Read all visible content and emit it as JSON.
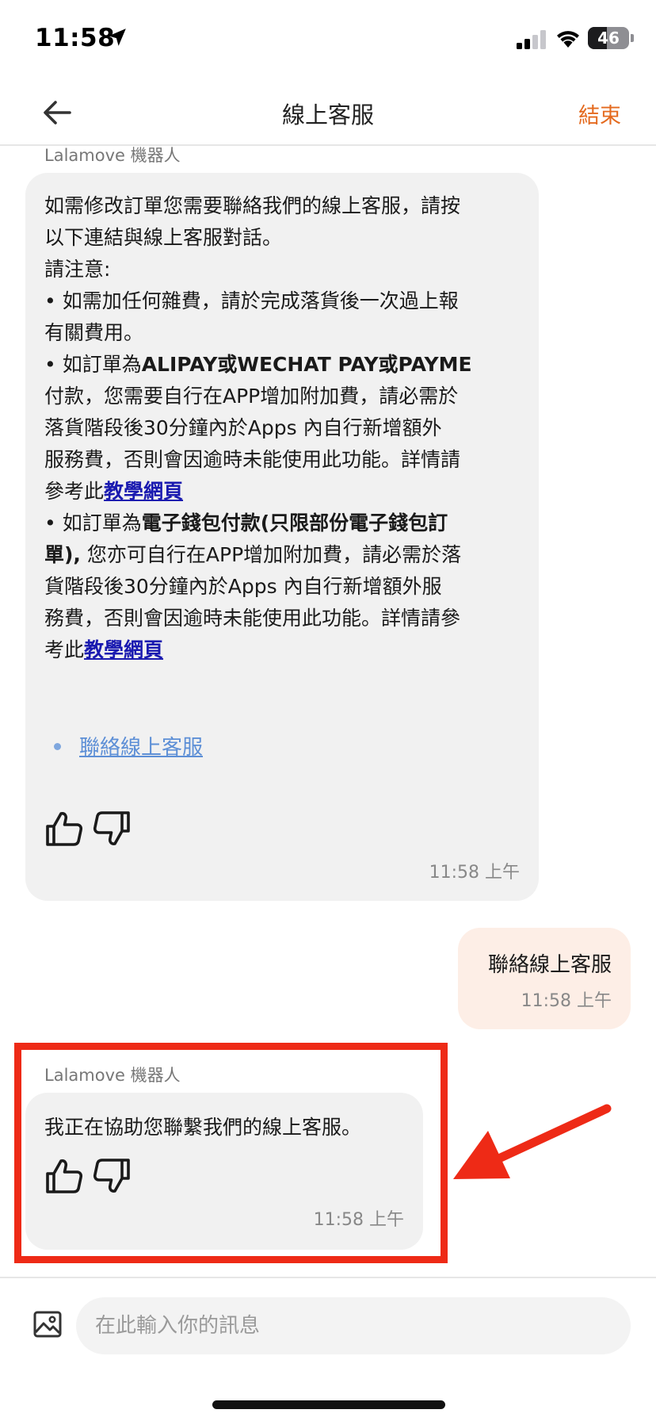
{
  "status_bar": {
    "time": "11:58",
    "battery": "46",
    "battery_level": 0.46
  },
  "header": {
    "title": "線上客服",
    "end_label": "結束"
  },
  "messages": {
    "bot1": {
      "sender": "Lalamove 機器人",
      "line1": "如需修改訂單您需要聯絡我們的線上客服，請按",
      "line2": "以下連結與線上客服對話。",
      "line3": "請注意:",
      "line4": "• 如需加任何雜費，請於完成落貨後一次過上報",
      "line5": "有關費用。",
      "line6_prefix": "• 如訂單為",
      "line6_bold": "ALIPAY或WECHAT PAY或PAYME",
      "line7": "付款，您需要自行在APP增加附加費，請必需於",
      "line8": "落貨階段後30分鐘內於Apps 內自行新增額外",
      "line9": "服務費，否則會因逾時未能使用此功能。詳情請",
      "line10_prefix": "參考此",
      "link1": "教學網頁",
      "line11_prefix": "• 如訂單為",
      "line11_bold": "電子錢包付款(只限部份電子錢包訂",
      "line12_bold": "單),",
      "line12_rest": " 您亦可自行在APP增加附加費，請必需於落",
      "line13": "貨階段後30分鐘內於Apps 內自行新增額外服",
      "line14": "務費，否則會因逾時未能使用此功能。詳情請參",
      "line15_prefix": "考此",
      "link2": "教學網頁",
      "cta": "聯絡線上客服",
      "time": "11:58 上午"
    },
    "user1": {
      "text": "聯絡線上客服",
      "time": "11:58 上午"
    },
    "bot2": {
      "sender": "Lalamove 機器人",
      "text": "我正在協助您聯繫我們的線上客服。",
      "time": "11:58 上午"
    }
  },
  "input": {
    "placeholder": "在此輸入你的訊息"
  },
  "icons": [
    "location-arrow-icon",
    "signal-icon",
    "wifi-icon",
    "battery-icon",
    "back-arrow-icon",
    "thumbs-up-icon",
    "thumbs-down-icon",
    "image-icon"
  ],
  "colors": {
    "accent": "#e46a1e",
    "highlight": "#ee2a16",
    "bot_bubble": "#f1f1f1",
    "user_bubble": "#fdeee6",
    "link": "#1a1ab0",
    "cta_link": "#5d8fd6"
  }
}
